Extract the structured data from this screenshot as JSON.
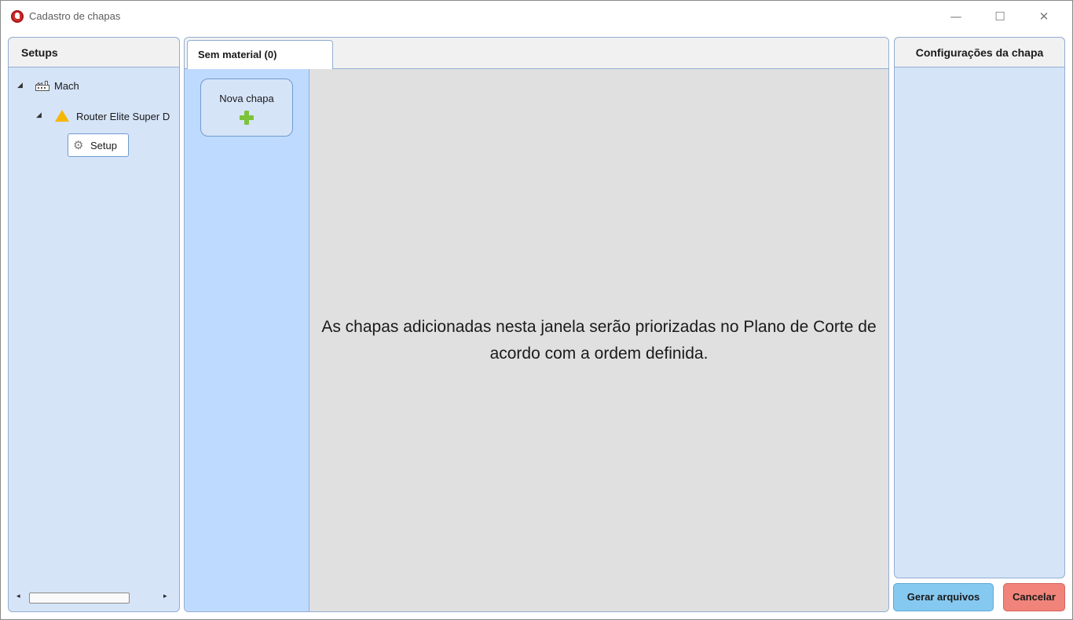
{
  "window": {
    "title": "Cadastro de chapas",
    "controls": {
      "minimize": "—",
      "maximize": "☐",
      "close": "✕"
    }
  },
  "setups_panel": {
    "header": "Setups",
    "tree": {
      "root": {
        "label": "Mach",
        "icon": "factory-icon",
        "expanded": true
      },
      "machine": {
        "label": "Router Elite Super D",
        "icon": "warning-icon",
        "expanded": true
      },
      "setup": {
        "label": "Setup",
        "icon": "gear-icon",
        "selected": true
      }
    },
    "scroll": {
      "left": "◂",
      "right": "▸"
    }
  },
  "tabs": [
    {
      "label": "Sem material (0)",
      "active": true
    }
  ],
  "sheets": {
    "new_sheet_label": "Nova chapa",
    "new_sheet_icon": "plus-icon",
    "empty_message": "As chapas adicionadas nesta janela serão priorizadas no Plano de Corte de acordo com a ordem definida."
  },
  "config_panel": {
    "header": "Configurações da chapa"
  },
  "actions": {
    "generate_label": "Gerar arquivos",
    "cancel_label": "Cancelar"
  },
  "colors": {
    "panel_bg": "#d6e4f8",
    "sheet_column_bg": "#bfdaff",
    "canvas_bg": "#e0e0e0",
    "generate_button": "#86c9f0",
    "cancel_button": "#f1847a",
    "plus_icon": "#7cc33a",
    "warning_icon": "#f5b700"
  }
}
